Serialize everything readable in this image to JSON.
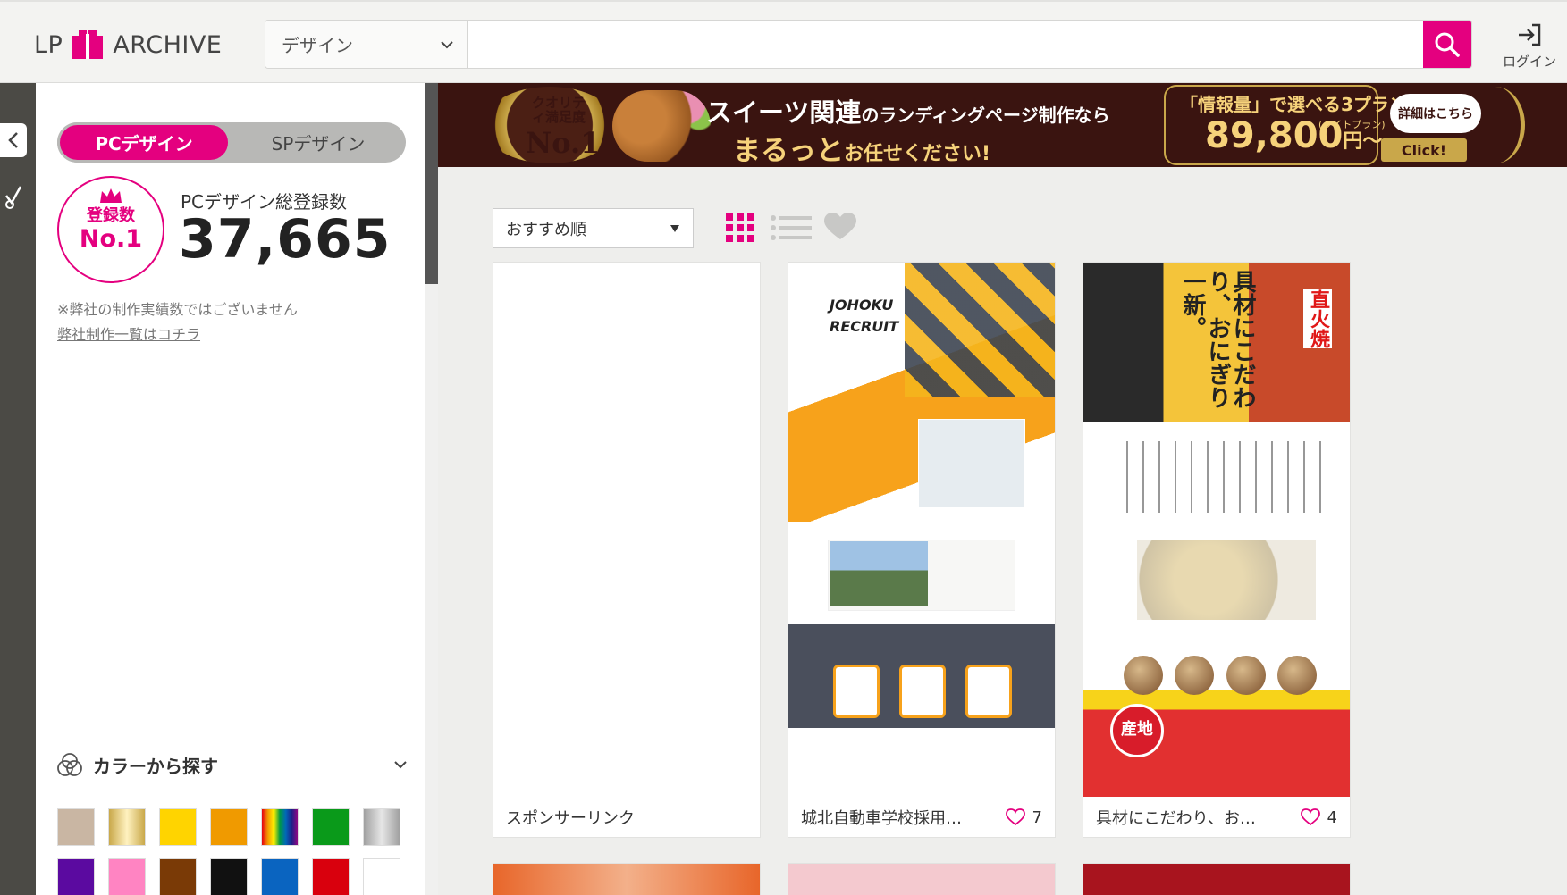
{
  "header": {
    "logo_left": "LP",
    "logo_right": "ARCHIVE",
    "category_value": "デザイン",
    "search_placeholder": "",
    "login_label": "ログイン"
  },
  "sidebar": {
    "toggle_pc": "PCデザイン",
    "toggle_sp": "SPデザイン",
    "badge_line1": "登録数",
    "badge_line2": "No.1",
    "stat_label": "PCデザイン総登録数",
    "stat_value": "37,665",
    "note": "※弊社の制作実績数ではございません",
    "note_link": "弊社制作一覧はコチラ",
    "color_search_label": "カラーから探す",
    "swatches": [
      "#c9b6a3",
      "#d9c07a",
      "#ffd400",
      "#f09a00",
      "rainbow",
      "#0a9a1a",
      "#b3b3b3",
      "#5b0aa0",
      "#ff84c2",
      "#7a3a06",
      "#111111",
      "#0a64c0",
      "#d9000d",
      "#ffffff"
    ]
  },
  "banner": {
    "quality_label": "クオリティ満足度",
    "quality_no1": "No.1",
    "main_line1_big": "スイーツ関連",
    "main_line1_small": "のランディングページ制作なら",
    "main_line2_big": "まるっと",
    "main_line2_small": "お任せください!",
    "plan_text": "「情報量」で選べる3プラン",
    "lite_plan": "(ライトプラン)",
    "price": "89,800",
    "price_suffix": "円〜",
    "detail_button": "詳細はこちら",
    "click_button": "Click!"
  },
  "toolbar": {
    "sort_value": "おすすめ順"
  },
  "cards": [
    {
      "title": "スポンサーリンク",
      "likes": ""
    },
    {
      "title": "城北自動車学校採用…",
      "likes": "7",
      "thumb_logo_line1": "JOHOKU",
      "thumb_logo_line2": "RECRUIT"
    },
    {
      "title": "具材にこだわり、お…",
      "likes": "4",
      "thumb_head": "具材にこだわり、おにぎり一新。",
      "thumb_red": "直火焼",
      "thumb_circle": "産地"
    }
  ],
  "colors": {
    "accent": "#e4007f",
    "rail": "#4b4a45",
    "banner_bg": "#3a1410",
    "banner_gold": "#f6d27a"
  }
}
